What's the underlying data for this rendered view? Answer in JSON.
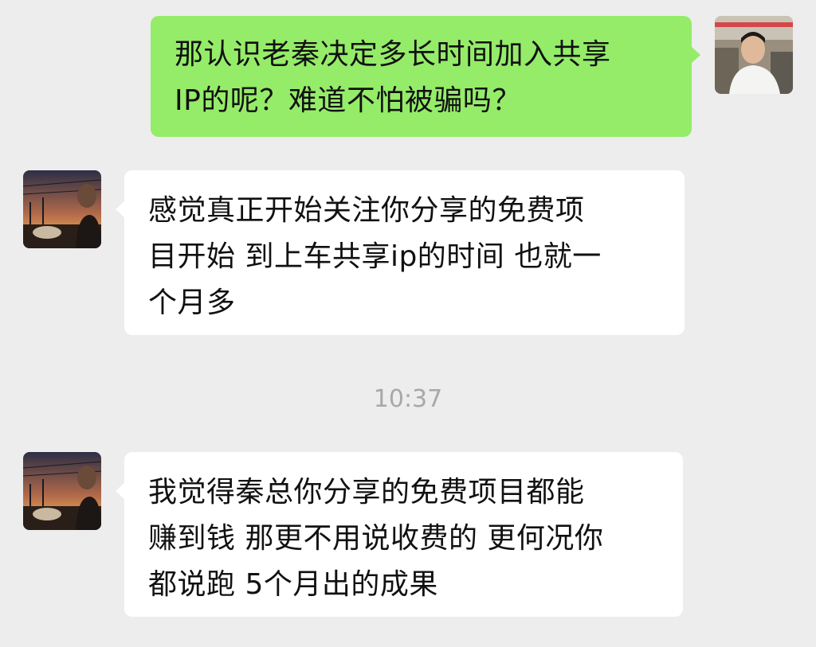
{
  "messages": [
    {
      "side": "sent",
      "lines": [
        "那认识老秦决定多长时间加入共享",
        "IP的呢？难道不怕被骗吗？"
      ]
    },
    {
      "side": "received",
      "lines": [
        "感觉真正开始关注你分享的免费项",
        "目开始 到上车共享ip的时间 也就一",
        "个月多"
      ]
    },
    {
      "side": "received",
      "lines": [
        "我觉得秦总你分享的免费项目都能",
        "赚到钱 那更不用说收费的 更何况你",
        "都说跑 5个月出的成果"
      ]
    }
  ],
  "timestamp": "10:37",
  "colors": {
    "background": "#ededed",
    "sent_bubble": "#95ec69",
    "received_bubble": "#ffffff",
    "timestamp_text": "#a8a8a8"
  }
}
